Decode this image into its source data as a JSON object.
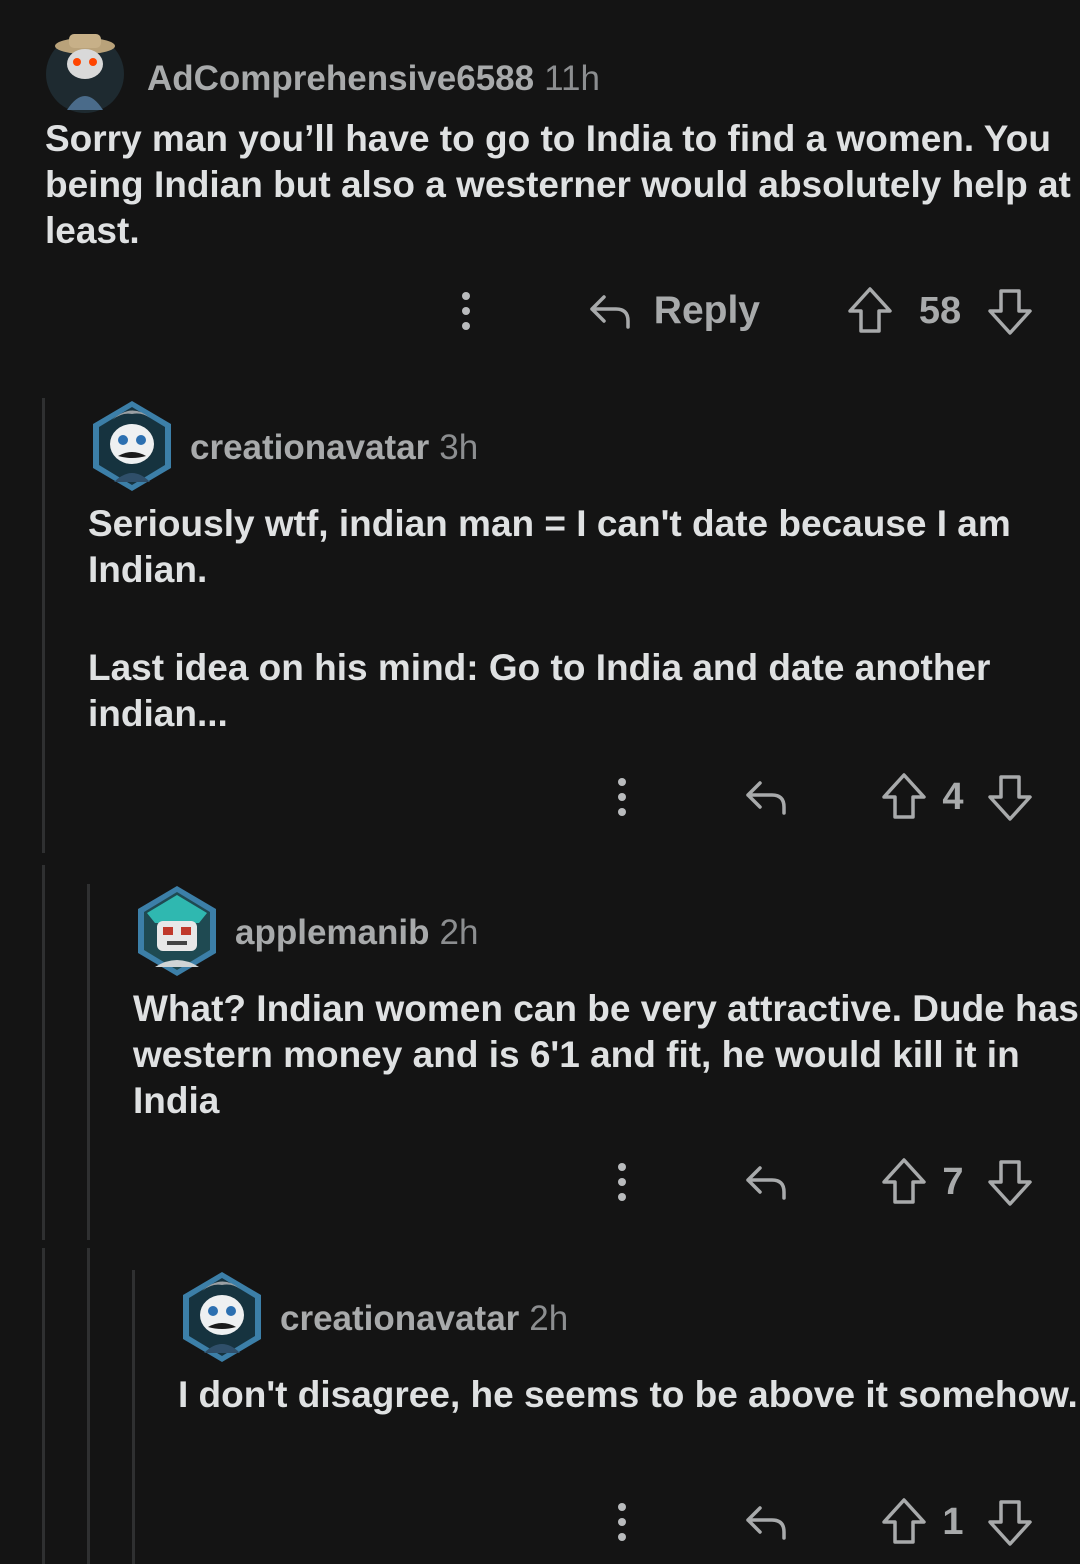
{
  "comments": [
    {
      "username": "AdComprehensive6588",
      "time": "11h",
      "paragraphs": [
        "Sorry man you’ll have to go to India to find a women. You being Indian but also a westerner would absolutely help at least."
      ],
      "reply_label": "Reply",
      "score": "58"
    },
    {
      "username": "creationavatar",
      "time": "3h",
      "paragraphs": [
        "Seriously wtf, indian man = I can't date because I am Indian.",
        "Last idea on his mind: Go to India and date another indian..."
      ],
      "score": "4"
    },
    {
      "username": "applemanib",
      "time": "2h",
      "paragraphs": [
        "What? Indian women can be very attractive. Dude has western money and is 6'1 and fit, he would kill it in India"
      ],
      "score": "7"
    },
    {
      "username": "creationavatar",
      "time": "2h",
      "paragraphs": [
        "I don't disagree, he seems to be above it somehow."
      ],
      "score": "1"
    }
  ],
  "icons": {
    "more": "more-vertical-icon",
    "reply": "reply-arrow-icon",
    "upvote": "upvote-arrow-icon",
    "downvote": "downvote-arrow-icon"
  },
  "colors": {
    "background": "#141414",
    "text": "#dfe1e2",
    "muted": "#a8aaab",
    "thread_line": "#2f3031",
    "avatar_hex": "#3c7fa8"
  }
}
